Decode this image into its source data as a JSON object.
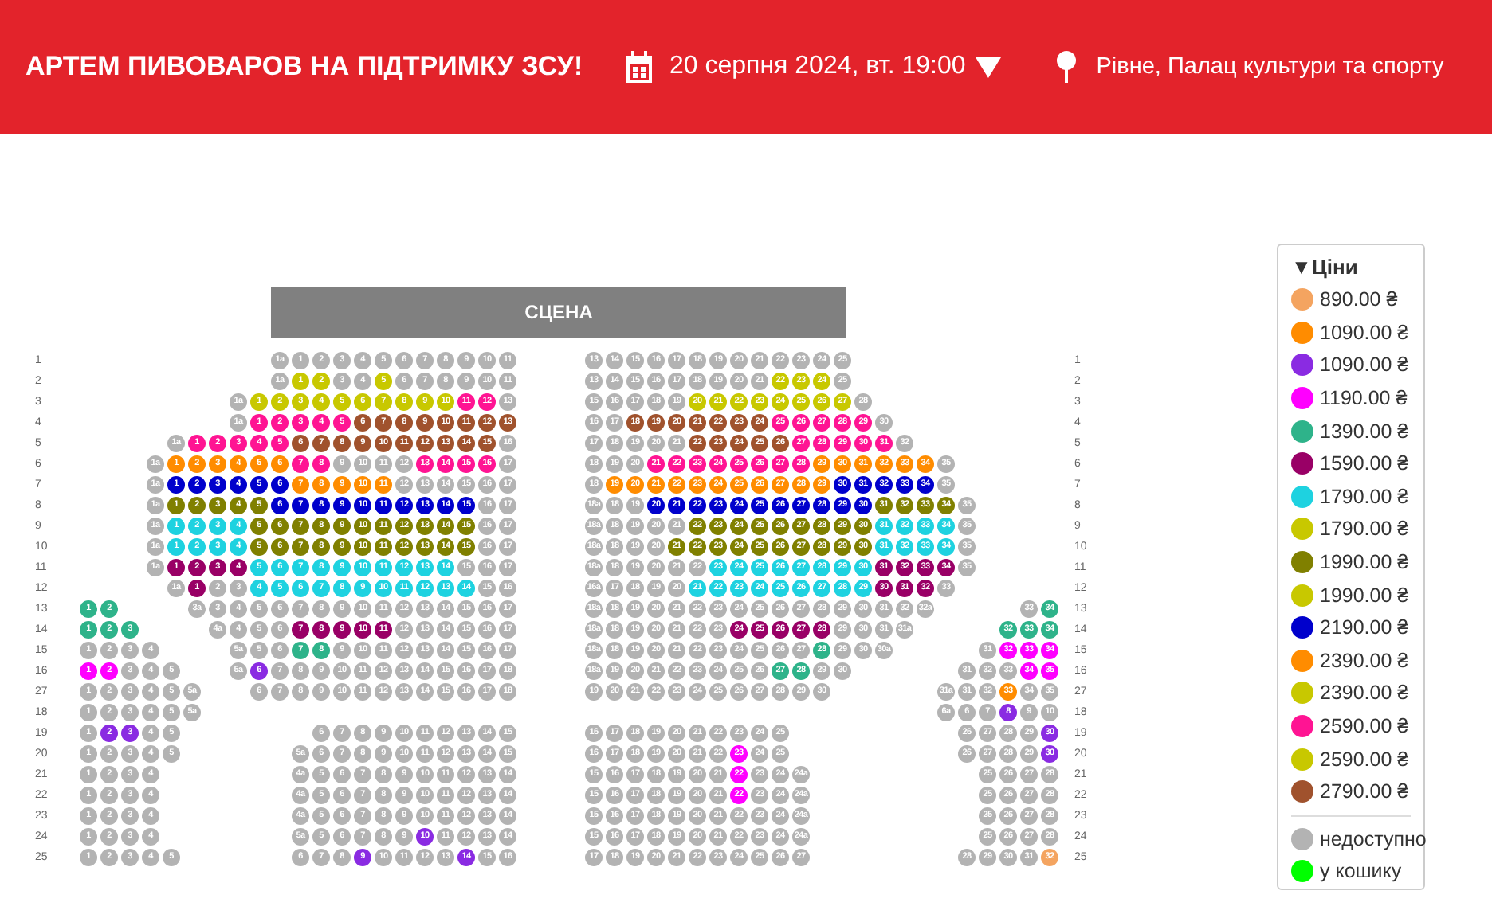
{
  "header": {
    "title": "АРТЕМ ПИВОВАРОВ НА ПІДТРИМКУ ЗСУ!",
    "date": "20 серпня 2024, вт. 19:00",
    "venue": "Рівне, Палац культури та спорту"
  },
  "stage": {
    "label": "СЦЕНА"
  },
  "rows": [
    {
      "label": "1",
      "inner_left": [
        {
          "color": "#b3b3b3",
          "seats": [
            "1a",
            "1",
            "2",
            "3",
            "4",
            "5",
            "6",
            "7",
            "8",
            "9",
            "10",
            "11"
          ]
        }
      ],
      "inner_right": [
        {
          "color": "#b3b3b3",
          "seats": [
            "13",
            "14",
            "15",
            "16",
            "17",
            "18",
            "19",
            "20",
            "21",
            "22",
            "23",
            "24",
            "25"
          ]
        }
      ],
      "right_label": "1"
    },
    {
      "label": "2",
      "inner_left": [
        {
          "color": "#b3b3b3",
          "seats": [
            "1a"
          ]
        },
        {
          "color": "#c8c800",
          "seats": [
            "1",
            "2"
          ]
        },
        {
          "color": "#b3b3b3",
          "seats": [
            "3",
            "4"
          ]
        },
        {
          "color": "#c8c800",
          "seats": [
            "5"
          ]
        },
        {
          "color": "#b3b3b3",
          "seats": [
            "6",
            "7",
            "8",
            "9",
            "10",
            "11"
          ]
        }
      ],
      "inner_right": [
        {
          "color": "#b3b3b3",
          "seats": [
            "13",
            "14",
            "15",
            "16",
            "17",
            "18",
            "19",
            "20",
            "21"
          ]
        },
        {
          "color": "#c8c800",
          "seats": [
            "22",
            "23",
            "24"
          ]
        },
        {
          "color": "#b3b3b3",
          "seats": [
            "25"
          ]
        }
      ],
      "right_label": "2"
    },
    {
      "label": "3",
      "inner_left": [
        {
          "color": "#b3b3b3",
          "seats": [
            "1a"
          ]
        },
        {
          "color": "#c8c800",
          "seats": [
            "1",
            "2",
            "3",
            "4",
            "5",
            "6",
            "7",
            "8",
            "9",
            "10"
          ]
        },
        {
          "color": "#ff1493",
          "seats": [
            "11",
            "12"
          ]
        },
        {
          "color": "#b3b3b3",
          "seats": [
            "13"
          ]
        }
      ],
      "inner_right": [
        {
          "color": "#b3b3b3",
          "seats": [
            "15",
            "16",
            "17",
            "18",
            "19"
          ]
        },
        {
          "color": "#c8c800",
          "seats": [
            "20",
            "21",
            "22",
            "23",
            "24",
            "25",
            "26",
            "27"
          ]
        },
        {
          "color": "#b3b3b3",
          "seats": [
            "28"
          ]
        }
      ],
      "right_label": "3"
    },
    {
      "label": "4",
      "inner_left": [
        {
          "color": "#b3b3b3",
          "seats": [
            "1a"
          ]
        },
        {
          "color": "#ff1493",
          "seats": [
            "1",
            "2",
            "3",
            "4",
            "5"
          ]
        },
        {
          "color": "#a0522d",
          "seats": [
            "6",
            "7",
            "8",
            "9",
            "10",
            "11",
            "12",
            "13"
          ]
        }
      ],
      "inner_right": [
        {
          "color": "#b3b3b3",
          "seats": [
            "16",
            "17"
          ]
        },
        {
          "color": "#a0522d",
          "seats": [
            "18",
            "19",
            "20",
            "21",
            "22",
            "23",
            "24"
          ]
        },
        {
          "color": "#ff1493",
          "seats": [
            "25",
            "26",
            "27",
            "28",
            "29"
          ]
        },
        {
          "color": "#b3b3b3",
          "seats": [
            "30"
          ]
        }
      ],
      "right_label": "4"
    },
    {
      "label": "5",
      "inner_left": [
        {
          "color": "#b3b3b3",
          "seats": [
            "1a"
          ]
        },
        {
          "color": "#ff1493",
          "seats": [
            "1",
            "2",
            "3",
            "4",
            "5"
          ]
        },
        {
          "color": "#a0522d",
          "seats": [
            "6",
            "7",
            "8",
            "9",
            "10",
            "11",
            "12",
            "13",
            "14",
            "15"
          ]
        },
        {
          "color": "#b3b3b3",
          "seats": [
            "16"
          ]
        }
      ],
      "inner_right": [
        {
          "color": "#b3b3b3",
          "seats": [
            "17",
            "18",
            "19",
            "20",
            "21"
          ]
        },
        {
          "color": "#a0522d",
          "seats": [
            "22",
            "23",
            "24",
            "25",
            "26"
          ]
        },
        {
          "color": "#ff1493",
          "seats": [
            "27",
            "28",
            "29",
            "30",
            "31"
          ]
        },
        {
          "color": "#b3b3b3",
          "seats": [
            "32"
          ]
        }
      ],
      "right_label": "5"
    },
    {
      "label": "6",
      "inner_left": [
        {
          "color": "#b3b3b3",
          "seats": [
            "1a"
          ]
        },
        {
          "color": "#ff8c00",
          "seats": [
            "1",
            "2",
            "3",
            "4",
            "5",
            "6"
          ]
        },
        {
          "color": "#ff1493",
          "seats": [
            "7",
            "8"
          ]
        },
        {
          "color": "#b3b3b3",
          "seats": [
            "9",
            "10",
            "11",
            "12"
          ]
        },
        {
          "color": "#ff1493",
          "seats": [
            "13",
            "14",
            "15",
            "16"
          ]
        },
        {
          "color": "#b3b3b3",
          "seats": [
            "17"
          ]
        }
      ],
      "inner_right": [
        {
          "color": "#b3b3b3",
          "seats": [
            "18",
            "19",
            "20"
          ]
        },
        {
          "color": "#ff1493",
          "seats": [
            "21",
            "22",
            "23",
            "24",
            "25",
            "26",
            "27",
            "28"
          ]
        },
        {
          "color": "#ff8c00",
          "seats": [
            "29",
            "30",
            "31",
            "32",
            "33",
            "34"
          ]
        },
        {
          "color": "#b3b3b3",
          "seats": [
            "35"
          ]
        }
      ],
      "right_label": "6"
    },
    {
      "label": "7",
      "inner_left": [
        {
          "color": "#b3b3b3",
          "seats": [
            "1a"
          ]
        },
        {
          "color": "#0000cc",
          "seats": [
            "1",
            "2",
            "3",
            "4",
            "5",
            "6"
          ]
        },
        {
          "color": "#ff8c00",
          "seats": [
            "7",
            "8",
            "9",
            "10",
            "11"
          ]
        },
        {
          "color": "#b3b3b3",
          "seats": [
            "12",
            "13",
            "14",
            "15",
            "16",
            "17"
          ]
        }
      ],
      "inner_right": [
        {
          "color": "#b3b3b3",
          "seats": [
            "18"
          ]
        },
        {
          "color": "#ff8c00",
          "seats": [
            "19",
            "20",
            "21",
            "22",
            "23",
            "24",
            "25",
            "26",
            "27",
            "28",
            "29"
          ]
        },
        {
          "color": "#0000cc",
          "seats": [
            "30",
            "31",
            "32",
            "33",
            "34"
          ]
        },
        {
          "color": "#b3b3b3",
          "seats": [
            "35"
          ]
        }
      ],
      "right_label": "7"
    },
    {
      "label": "8",
      "inner_left": [
        {
          "color": "#b3b3b3",
          "seats": [
            "1a"
          ]
        },
        {
          "color": "#808000",
          "seats": [
            "1",
            "2",
            "3",
            "4",
            "5"
          ]
        },
        {
          "color": "#0000cc",
          "seats": [
            "6",
            "7",
            "8",
            "9",
            "10",
            "11",
            "12",
            "13",
            "14",
            "15"
          ]
        },
        {
          "color": "#b3b3b3",
          "seats": [
            "16",
            "17"
          ]
        }
      ],
      "inner_right": [
        {
          "color": "#b3b3b3",
          "seats": [
            "18a",
            "18",
            "19"
          ]
        },
        {
          "color": "#0000cc",
          "seats": [
            "20",
            "21",
            "22",
            "23",
            "24",
            "25",
            "26",
            "27",
            "28",
            "29",
            "30"
          ]
        },
        {
          "color": "#808000",
          "seats": [
            "31",
            "32",
            "33",
            "34"
          ]
        },
        {
          "color": "#b3b3b3",
          "seats": [
            "35"
          ]
        }
      ],
      "right_label": "8"
    },
    {
      "label": "9",
      "inner_left": [
        {
          "color": "#b3b3b3",
          "seats": [
            "1a"
          ]
        },
        {
          "color": "#1ed2e0",
          "seats": [
            "1",
            "2",
            "3",
            "4"
          ]
        },
        {
          "color": "#808000",
          "seats": [
            "5",
            "6",
            "7",
            "8",
            "9",
            "10",
            "11",
            "12",
            "13",
            "14",
            "15"
          ]
        },
        {
          "color": "#b3b3b3",
          "seats": [
            "16",
            "17"
          ]
        }
      ],
      "inner_right": [
        {
          "color": "#b3b3b3",
          "seats": [
            "18a",
            "18",
            "19",
            "20",
            "21"
          ]
        },
        {
          "color": "#808000",
          "seats": [
            "22",
            "23",
            "24",
            "25",
            "26",
            "27",
            "28",
            "29",
            "30"
          ]
        },
        {
          "color": "#1ed2e0",
          "seats": [
            "31",
            "32",
            "33",
            "34"
          ]
        },
        {
          "color": "#b3b3b3",
          "seats": [
            "35"
          ]
        }
      ],
      "right_label": "9"
    },
    {
      "label": "10",
      "inner_left": [
        {
          "color": "#b3b3b3",
          "seats": [
            "1a"
          ]
        },
        {
          "color": "#1ed2e0",
          "seats": [
            "1",
            "2",
            "3",
            "4"
          ]
        },
        {
          "color": "#808000",
          "seats": [
            "5",
            "6",
            "7",
            "8",
            "9",
            "10",
            "11",
            "12",
            "13",
            "14",
            "15"
          ]
        },
        {
          "color": "#b3b3b3",
          "seats": [
            "16",
            "17"
          ]
        }
      ],
      "inner_right": [
        {
          "color": "#b3b3b3",
          "seats": [
            "18a",
            "18",
            "19",
            "20"
          ]
        },
        {
          "color": "#808000",
          "seats": [
            "21",
            "22",
            "23",
            "24",
            "25",
            "26",
            "27",
            "28",
            "29",
            "30"
          ]
        },
        {
          "color": "#1ed2e0",
          "seats": [
            "31",
            "32",
            "33",
            "34"
          ]
        },
        {
          "color": "#b3b3b3",
          "seats": [
            "35"
          ]
        }
      ],
      "right_label": "10"
    },
    {
      "label": "11",
      "inner_left": [
        {
          "color": "#b3b3b3",
          "seats": [
            "1a"
          ]
        },
        {
          "color": "#990066",
          "seats": [
            "1",
            "2",
            "3",
            "4"
          ]
        },
        {
          "color": "#1ed2e0",
          "seats": [
            "5",
            "6",
            "7",
            "8",
            "9",
            "10",
            "11",
            "12",
            "13",
            "14"
          ]
        },
        {
          "color": "#b3b3b3",
          "seats": [
            "15",
            "16",
            "17"
          ]
        }
      ],
      "inner_right": [
        {
          "color": "#b3b3b3",
          "seats": [
            "18a",
            "18",
            "19",
            "20",
            "21",
            "22"
          ]
        },
        {
          "color": "#1ed2e0",
          "seats": [
            "23",
            "24",
            "25",
            "26",
            "27",
            "28",
            "29",
            "30"
          ]
        },
        {
          "color": "#990066",
          "seats": [
            "31",
            "32",
            "33",
            "34"
          ]
        },
        {
          "color": "#b3b3b3",
          "seats": [
            "35"
          ]
        }
      ],
      "right_label": "11"
    },
    {
      "label": "12",
      "inner_left": [
        {
          "color": "#b3b3b3",
          "seats": [
            "1a"
          ]
        },
        {
          "color": "#990066",
          "seats": [
            "1"
          ]
        },
        {
          "color": "#b3b3b3",
          "seats": [
            "2",
            "3"
          ]
        },
        {
          "color": "#1ed2e0",
          "seats": [
            "4",
            "5",
            "6",
            "7",
            "8",
            "9",
            "10",
            "11",
            "12",
            "13",
            "14"
          ]
        },
        {
          "color": "#b3b3b3",
          "seats": [
            "15",
            "16"
          ]
        }
      ],
      "inner_right": [
        {
          "color": "#b3b3b3",
          "seats": [
            "16a",
            "17",
            "18",
            "19",
            "20"
          ]
        },
        {
          "color": "#1ed2e0",
          "seats": [
            "21",
            "22",
            "23",
            "24",
            "25",
            "26",
            "27",
            "28",
            "29"
          ]
        },
        {
          "color": "#990066",
          "seats": [
            "30",
            "31",
            "32"
          ]
        },
        {
          "color": "#b3b3b3",
          "seats": [
            "33"
          ]
        }
      ],
      "right_label": "12"
    },
    {
      "label": "13",
      "outer_left": [
        {
          "color": "#2eb38a",
          "seats": [
            "1",
            "2"
          ]
        }
      ],
      "inner_left": [
        {
          "color": "#b3b3b3",
          "seats": [
            "3a",
            "3",
            "4",
            "5",
            "6",
            "7",
            "8",
            "9",
            "10",
            "11",
            "12",
            "13",
            "14",
            "15",
            "16",
            "17"
          ]
        }
      ],
      "inner_right": [
        {
          "color": "#b3b3b3",
          "seats": [
            "18a",
            "18",
            "19",
            "20",
            "21",
            "22",
            "23",
            "24",
            "25",
            "26",
            "27",
            "28",
            "29",
            "30",
            "31",
            "32",
            "32a"
          ]
        }
      ],
      "outer_right": [
        {
          "color": "#b3b3b3",
          "seats": [
            "33"
          ]
        },
        {
          "color": "#2eb38a",
          "seats": [
            "34"
          ]
        }
      ],
      "right_label": "13"
    },
    {
      "label": "14",
      "outer_left": [
        {
          "color": "#2eb38a",
          "seats": [
            "1",
            "2",
            "3"
          ]
        }
      ],
      "inner_left": [
        {
          "color": "#b3b3b3",
          "seats": [
            "4a",
            "4",
            "5",
            "6"
          ]
        },
        {
          "color": "#990066",
          "seats": [
            "7",
            "8",
            "9",
            "10",
            "11"
          ]
        },
        {
          "color": "#b3b3b3",
          "seats": [
            "12",
            "13",
            "14",
            "15",
            "16",
            "17"
          ]
        }
      ],
      "inner_right": [
        {
          "color": "#b3b3b3",
          "seats": [
            "18a",
            "18",
            "19",
            "20",
            "21",
            "22",
            "23"
          ]
        },
        {
          "color": "#990066",
          "seats": [
            "24",
            "25",
            "26",
            "27",
            "28"
          ]
        },
        {
          "color": "#b3b3b3",
          "seats": [
            "29",
            "30",
            "31",
            "31a"
          ]
        }
      ],
      "outer_right": [
        {
          "color": "#2eb38a",
          "seats": [
            "32",
            "33",
            "34"
          ]
        }
      ],
      "right_label": "14"
    },
    {
      "label": "15",
      "outer_left": [
        {
          "color": "#b3b3b3",
          "seats": [
            "1",
            "2",
            "3",
            "4"
          ]
        }
      ],
      "inner_left": [
        {
          "color": "#b3b3b3",
          "seats": [
            "5a",
            "5",
            "6"
          ]
        },
        {
          "color": "#2eb38a",
          "seats": [
            "7",
            "8"
          ]
        },
        {
          "color": "#b3b3b3",
          "seats": [
            "9",
            "10",
            "11",
            "12",
            "13",
            "14",
            "15",
            "16",
            "17"
          ]
        }
      ],
      "inner_right": [
        {
          "color": "#b3b3b3",
          "seats": [
            "18a",
            "18",
            "19",
            "20",
            "21",
            "22",
            "23",
            "24",
            "25",
            "26",
            "27"
          ]
        },
        {
          "color": "#2eb38a",
          "seats": [
            "28"
          ]
        },
        {
          "color": "#b3b3b3",
          "seats": [
            "29",
            "30",
            "30a"
          ]
        }
      ],
      "outer_right": [
        {
          "color": "#b3b3b3",
          "seats": [
            "31"
          ]
        },
        {
          "color": "#ff00ff",
          "seats": [
            "32",
            "33",
            "34"
          ]
        }
      ],
      "right_label": "15"
    },
    {
      "label": "16",
      "outer_left": [
        {
          "color": "#ff00ff",
          "seats": [
            "1",
            "2"
          ]
        },
        {
          "color": "#b3b3b3",
          "seats": [
            "3",
            "4",
            "5"
          ]
        }
      ],
      "inner_left": [
        {
          "color": "#b3b3b3",
          "seats": [
            "5a"
          ]
        },
        {
          "color": "#8a2be2",
          "seats": [
            "6"
          ]
        },
        {
          "color": "#b3b3b3",
          "seats": [
            "7",
            "8",
            "9",
            "10",
            "11",
            "12",
            "13",
            "14",
            "15",
            "16",
            "17",
            "18"
          ]
        }
      ],
      "inner_right": [
        {
          "color": "#b3b3b3",
          "seats": [
            "18a",
            "19",
            "20",
            "21",
            "22",
            "23",
            "24",
            "25",
            "26"
          ]
        },
        {
          "color": "#2eb38a",
          "seats": [
            "27",
            "28"
          ]
        },
        {
          "color": "#b3b3b3",
          "seats": [
            "29",
            "30"
          ]
        }
      ],
      "outer_right": [
        {
          "color": "#b3b3b3",
          "seats": [
            "31",
            "32",
            "33"
          ]
        },
        {
          "color": "#ff00ff",
          "seats": [
            "34",
            "35"
          ]
        }
      ],
      "right_label": "16"
    },
    {
      "label": "27",
      "outer_left": [
        {
          "color": "#b3b3b3",
          "seats": [
            "1",
            "2",
            "3",
            "4",
            "5",
            "5a"
          ]
        }
      ],
      "inner_left": [
        {
          "color": "#b3b3b3",
          "seats": [
            "6",
            "7",
            "8",
            "9",
            "10",
            "11",
            "12",
            "13",
            "14",
            "15",
            "16",
            "17",
            "18"
          ]
        }
      ],
      "inner_right": [
        {
          "color": "#b3b3b3",
          "seats": [
            "19",
            "20",
            "21",
            "22",
            "23",
            "24",
            "25",
            "26",
            "27",
            "28",
            "29",
            "30"
          ]
        }
      ],
      "outer_right": [
        {
          "color": "#b3b3b3",
          "seats": [
            "31a",
            "31",
            "32"
          ]
        },
        {
          "color": "#ff8c00",
          "seats": [
            "33"
          ]
        },
        {
          "color": "#b3b3b3",
          "seats": [
            "34",
            "35"
          ]
        }
      ],
      "right_label": "27"
    },
    {
      "label": "18",
      "outer_left": [
        {
          "color": "#b3b3b3",
          "seats": [
            "1",
            "2",
            "3",
            "4",
            "5",
            "5a"
          ]
        }
      ],
      "outer_right": [
        {
          "color": "#b3b3b3",
          "seats": [
            "6a",
            "6",
            "7"
          ]
        },
        {
          "color": "#8a2be2",
          "seats": [
            "8"
          ]
        },
        {
          "color": "#b3b3b3",
          "seats": [
            "9",
            "10"
          ]
        }
      ],
      "right_label": "18"
    },
    {
      "label": "19",
      "outer_left": [
        {
          "color": "#b3b3b3",
          "seats": [
            "1"
          ]
        },
        {
          "color": "#8a2be2",
          "seats": [
            "2",
            "3"
          ]
        },
        {
          "color": "#b3b3b3",
          "seats": [
            "4",
            "5"
          ]
        }
      ],
      "inner_left": [
        {
          "color": "#b3b3b3",
          "seats": [
            "6",
            "7",
            "8",
            "9",
            "10",
            "11",
            "12",
            "13",
            "14",
            "15"
          ]
        }
      ],
      "inner_right": [
        {
          "color": "#b3b3b3",
          "seats": [
            "16",
            "17",
            "18",
            "19",
            "20",
            "21",
            "22",
            "23",
            "24",
            "25"
          ]
        }
      ],
      "outer_right": [
        {
          "color": "#b3b3b3",
          "seats": [
            "26",
            "27",
            "28",
            "29"
          ]
        },
        {
          "color": "#8a2be2",
          "seats": [
            "30"
          ]
        }
      ],
      "right_label": "19"
    },
    {
      "label": "20",
      "outer_left": [
        {
          "color": "#b3b3b3",
          "seats": [
            "1",
            "2",
            "3",
            "4",
            "5"
          ]
        }
      ],
      "inner_left": [
        {
          "color": "#b3b3b3",
          "seats": [
            "5a",
            "6",
            "7",
            "8",
            "9",
            "10",
            "11",
            "12",
            "13",
            "14",
            "15"
          ]
        }
      ],
      "inner_right": [
        {
          "color": "#b3b3b3",
          "seats": [
            "16",
            "17",
            "18",
            "19",
            "20",
            "21",
            "22"
          ]
        },
        {
          "color": "#ff00ff",
          "seats": [
            "23"
          ]
        },
        {
          "color": "#b3b3b3",
          "seats": [
            "24",
            "25"
          ]
        }
      ],
      "outer_right": [
        {
          "color": "#b3b3b3",
          "seats": [
            "26",
            "27",
            "28",
            "29"
          ]
        },
        {
          "color": "#8a2be2",
          "seats": [
            "30"
          ]
        }
      ],
      "right_label": "20"
    },
    {
      "label": "21",
      "outer_left": [
        {
          "color": "#b3b3b3",
          "seats": [
            "1",
            "2",
            "3",
            "4"
          ]
        }
      ],
      "inner_left": [
        {
          "color": "#b3b3b3",
          "seats": [
            "4a",
            "5",
            "6",
            "7",
            "8",
            "9",
            "10",
            "11",
            "12",
            "13",
            "14"
          ]
        }
      ],
      "inner_right": [
        {
          "color": "#b3b3b3",
          "seats": [
            "15",
            "16",
            "17",
            "18",
            "19",
            "20",
            "21"
          ]
        },
        {
          "color": "#ff00ff",
          "seats": [
            "22"
          ]
        },
        {
          "color": "#b3b3b3",
          "seats": [
            "23",
            "24",
            "24a"
          ]
        }
      ],
      "outer_right": [
        {
          "color": "#b3b3b3",
          "seats": [
            "25",
            "26",
            "27",
            "28"
          ]
        }
      ],
      "right_label": "21"
    },
    {
      "label": "22",
      "outer_left": [
        {
          "color": "#b3b3b3",
          "seats": [
            "1",
            "2",
            "3",
            "4"
          ]
        }
      ],
      "inner_left": [
        {
          "color": "#b3b3b3",
          "seats": [
            "4a",
            "5",
            "6",
            "7",
            "8",
            "9",
            "10",
            "11",
            "12",
            "13",
            "14"
          ]
        }
      ],
      "inner_right": [
        {
          "color": "#b3b3b3",
          "seats": [
            "15",
            "16",
            "17",
            "18",
            "19",
            "20",
            "21"
          ]
        },
        {
          "color": "#ff00ff",
          "seats": [
            "22"
          ]
        },
        {
          "color": "#b3b3b3",
          "seats": [
            "23",
            "24",
            "24a"
          ]
        }
      ],
      "outer_right": [
        {
          "color": "#b3b3b3",
          "seats": [
            "25",
            "26",
            "27",
            "28"
          ]
        }
      ],
      "right_label": "22"
    },
    {
      "label": "23",
      "outer_left": [
        {
          "color": "#b3b3b3",
          "seats": [
            "1",
            "2",
            "3",
            "4"
          ]
        }
      ],
      "inner_left": [
        {
          "color": "#b3b3b3",
          "seats": [
            "4a",
            "5",
            "6",
            "7",
            "8",
            "9",
            "10",
            "11",
            "12",
            "13",
            "14"
          ]
        }
      ],
      "inner_right": [
        {
          "color": "#b3b3b3",
          "seats": [
            "15",
            "16",
            "17",
            "18",
            "19",
            "20",
            "21",
            "22",
            "23",
            "24",
            "24a"
          ]
        }
      ],
      "outer_right": [
        {
          "color": "#b3b3b3",
          "seats": [
            "25",
            "26",
            "27",
            "28"
          ]
        }
      ],
      "right_label": "23"
    },
    {
      "label": "24",
      "outer_left": [
        {
          "color": "#b3b3b3",
          "seats": [
            "1",
            "2",
            "3",
            "4"
          ]
        }
      ],
      "inner_left": [
        {
          "color": "#b3b3b3",
          "seats": [
            "5a",
            "5",
            "6",
            "7",
            "8",
            "9"
          ]
        },
        {
          "color": "#8a2be2",
          "seats": [
            "10"
          ]
        },
        {
          "color": "#b3b3b3",
          "seats": [
            "11",
            "12",
            "13",
            "14"
          ]
        }
      ],
      "inner_right": [
        {
          "color": "#b3b3b3",
          "seats": [
            "15",
            "16",
            "17",
            "18",
            "19",
            "20",
            "21",
            "22",
            "23",
            "24",
            "24a"
          ]
        }
      ],
      "outer_right": [
        {
          "color": "#b3b3b3",
          "seats": [
            "25",
            "26",
            "27",
            "28"
          ]
        }
      ],
      "right_label": "24"
    },
    {
      "label": "25",
      "outer_left": [
        {
          "color": "#b3b3b3",
          "seats": [
            "1",
            "2",
            "3",
            "4",
            "5"
          ]
        }
      ],
      "inner_left": [
        {
          "color": "#b3b3b3",
          "seats": [
            "6",
            "7",
            "8"
          ]
        },
        {
          "color": "#8a2be2",
          "seats": [
            "9"
          ]
        },
        {
          "color": "#b3b3b3",
          "seats": [
            "10",
            "11",
            "12",
            "13"
          ]
        },
        {
          "color": "#8a2be2",
          "seats": [
            "14"
          ]
        },
        {
          "color": "#b3b3b3",
          "seats": [
            "15",
            "16"
          ]
        }
      ],
      "inner_right": [
        {
          "color": "#b3b3b3",
          "seats": [
            "17",
            "18",
            "19",
            "20",
            "21",
            "22",
            "23",
            "24",
            "25",
            "26",
            "27"
          ]
        }
      ],
      "outer_right": [
        {
          "color": "#b3b3b3",
          "seats": [
            "28",
            "29",
            "30",
            "31"
          ]
        },
        {
          "color": "#f4a460",
          "seats": [
            "32"
          ]
        }
      ],
      "right_label": "25"
    }
  ],
  "legend": {
    "title": "▼Ціни",
    "prices": [
      {
        "label": "890.00 ₴",
        "color": "#f4a460"
      },
      {
        "label": "1090.00 ₴",
        "color": "#ff8c00"
      },
      {
        "label": "1090.00 ₴",
        "color": "#8a2be2"
      },
      {
        "label": "1190.00 ₴",
        "color": "#ff00ff"
      },
      {
        "label": "1390.00 ₴",
        "color": "#2eb38a"
      },
      {
        "label": "1590.00 ₴",
        "color": "#990066"
      },
      {
        "label": "1790.00 ₴",
        "color": "#1ed2e0"
      },
      {
        "label": "1790.00 ₴",
        "color": "#c8c800"
      },
      {
        "label": "1990.00 ₴",
        "color": "#808000"
      },
      {
        "label": "1990.00 ₴",
        "color": "#c8c800"
      },
      {
        "label": "2190.00 ₴",
        "color": "#0000cc"
      },
      {
        "label": "2390.00 ₴",
        "color": "#ff8c00"
      },
      {
        "label": "2390.00 ₴",
        "color": "#c8c800"
      },
      {
        "label": "2590.00 ₴",
        "color": "#ff1493"
      },
      {
        "label": "2590.00 ₴",
        "color": "#c8c800"
      },
      {
        "label": "2790.00 ₴",
        "color": "#a0522d"
      }
    ],
    "statuses": [
      {
        "label": "недоступно",
        "color": "#b3b3b3"
      },
      {
        "label": "у кошику",
        "color": "#00ff00"
      }
    ]
  }
}
